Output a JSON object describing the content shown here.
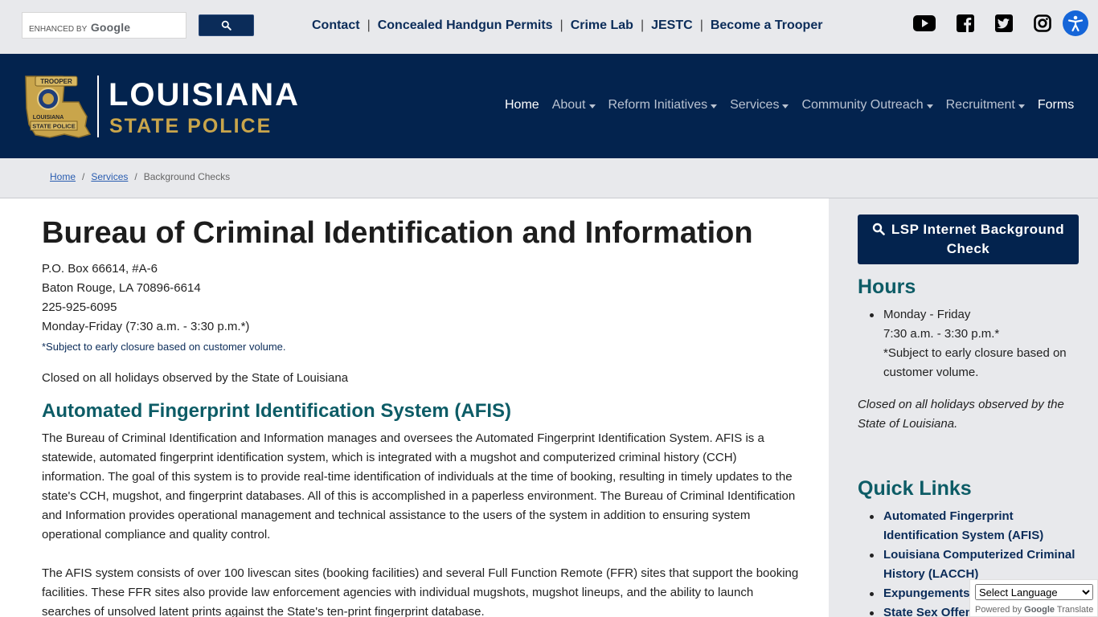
{
  "utility": {
    "search_brand_prefix": "ENHANCED BY",
    "search_brand_name": "Google",
    "top_links": [
      "Contact",
      "Concealed Handgun Permits",
      "Crime Lab",
      "JESTC",
      "Become a Trooper"
    ],
    "social_icons": [
      "youtube-icon",
      "facebook-icon",
      "twitter-icon",
      "instagram-icon"
    ],
    "accessibility_icon": "accessibility-icon"
  },
  "header": {
    "logo_title": "LOUISIANA",
    "logo_subtitle": "STATE POLICE",
    "badge_top": "TROOPER",
    "badge_mid": "LOUISIANA",
    "badge_bottom": "STATE POLICE",
    "nav": [
      {
        "label": "Home",
        "dropdown": false
      },
      {
        "label": "About",
        "dropdown": true
      },
      {
        "label": "Reform Initiatives",
        "dropdown": true
      },
      {
        "label": "Services",
        "dropdown": true
      },
      {
        "label": "Community Outreach",
        "dropdown": true
      },
      {
        "label": "Recruitment",
        "dropdown": true
      },
      {
        "label": "Forms",
        "dropdown": false
      }
    ],
    "colors": {
      "navy": "#03234e",
      "gold": "#c9a54b",
      "teal": "#0d5c66"
    }
  },
  "breadcrumb": {
    "items": [
      "Home",
      "Services",
      "Background Checks"
    ]
  },
  "main": {
    "title": "Bureau of Criminal Identification and Information",
    "address": [
      "P.O. Box 66614, #A-6",
      "Baton Rouge, LA 70896-6614",
      "225-925-6095",
      "Monday-Friday (7:30 a.m. - 3:30 p.m.*)"
    ],
    "note": "*Subject to early closure based on customer volume.",
    "closed": "Closed on all holidays observed by the State of Louisiana",
    "section_title": "Automated Fingerprint Identification System (AFIS)",
    "paragraph1": "The Bureau of Criminal Identification and Information manages and oversees the Automated Fingerprint Identification System. AFIS is a statewide, automated fingerprint identification system, which is integrated with a mugshot and computerized criminal history (CCH) information. The goal of this system is to provide real-time identification of individuals at the time of booking, resulting in timely updates to the state's CCH, mugshot, and fingerprint databases. All of this is accomplished in a paperless environment. The Bureau of Criminal Identification and Information provides operational management and technical assistance to the users of the system in addition to ensuring system operational compliance and quality control.",
    "paragraph2": "The AFIS system consists of over 100 livescan sites (booking facilities) and several Full Function Remote (FFR) sites that support the booking facilities. These FFR sites also provide law enforcement agencies with individual mugshots, mugshot lineups, and the ability to launch searches of unsolved latent prints against the State's ten-print fingerprint database."
  },
  "sidebar": {
    "cta_label": "LSP Internet Background Check",
    "hours_heading": "Hours",
    "hours_items": [
      "Monday - Friday",
      "7:30 a.m. - 3:30 p.m.*",
      "*Subject to early closure based on customer volume."
    ],
    "closed": "Closed on all holidays observed by the State of Louisiana.",
    "quick_heading": "Quick Links",
    "quick_links": [
      "Automated Fingerprint Identification System (AFIS)",
      "Louisiana Computerized Criminal History (LACCH)",
      "Expungements",
      "State Sex Offender"
    ]
  },
  "translate": {
    "select_value": "Select Language",
    "powered_by": "Powered by",
    "google": "Google",
    "translate": "Translate"
  }
}
